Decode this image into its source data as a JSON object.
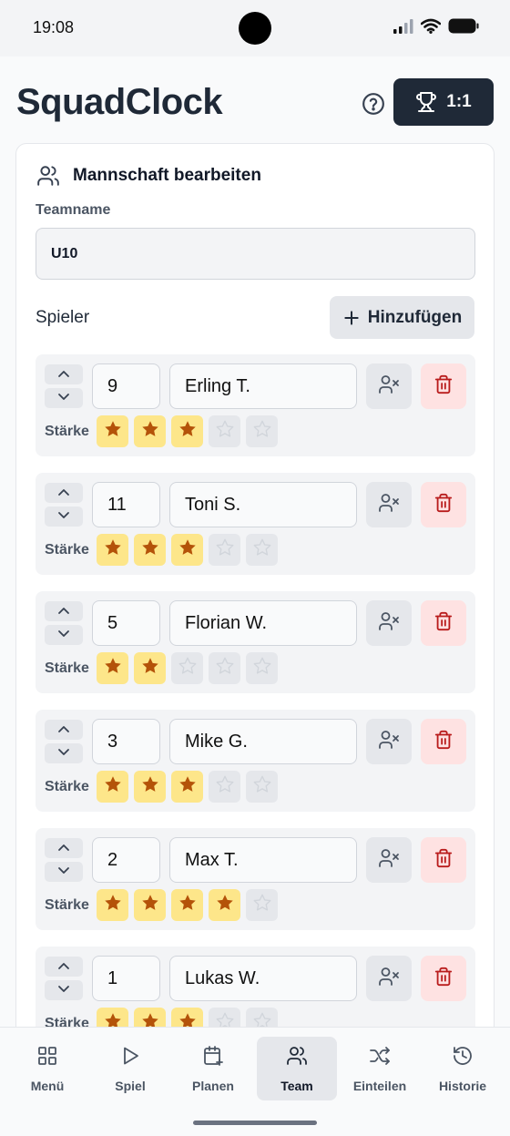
{
  "status_bar": {
    "time": "19:08"
  },
  "header": {
    "app_title": "SquadClock",
    "score_label": "1:1"
  },
  "team_card": {
    "title": "Mannschaft bearbeiten",
    "teamname_label": "Teamname",
    "teamname_value": "U10",
    "players_label": "Spieler",
    "add_button_label": "Hinzufügen",
    "strength_label": "Stärke",
    "max_stars": 5
  },
  "players": [
    {
      "number": "9",
      "name": "Erling T.",
      "strength": 3
    },
    {
      "number": "11",
      "name": "Toni S.",
      "strength": 3
    },
    {
      "number": "5",
      "name": "Florian W.",
      "strength": 2
    },
    {
      "number": "3",
      "name": "Mike G.",
      "strength": 3
    },
    {
      "number": "2",
      "name": "Max T.",
      "strength": 4
    },
    {
      "number": "1",
      "name": "Lukas W.",
      "strength": 3
    }
  ],
  "bottom_nav": [
    {
      "label": "Menü",
      "icon": "grid-icon",
      "active": false
    },
    {
      "label": "Spiel",
      "icon": "play-icon",
      "active": false
    },
    {
      "label": "Planen",
      "icon": "calendar-plus-icon",
      "active": false
    },
    {
      "label": "Team",
      "icon": "users-icon",
      "active": true
    },
    {
      "label": "Einteilen",
      "icon": "shuffle-icon",
      "active": false
    },
    {
      "label": "Historie",
      "icon": "history-icon",
      "active": false
    }
  ],
  "colors": {
    "star_active_bg": "#fde68a",
    "star_active": "#b45309",
    "delete_bg": "#fee2e2",
    "delete_icon": "#b91c1c",
    "score_button_bg": "#1f2937"
  }
}
